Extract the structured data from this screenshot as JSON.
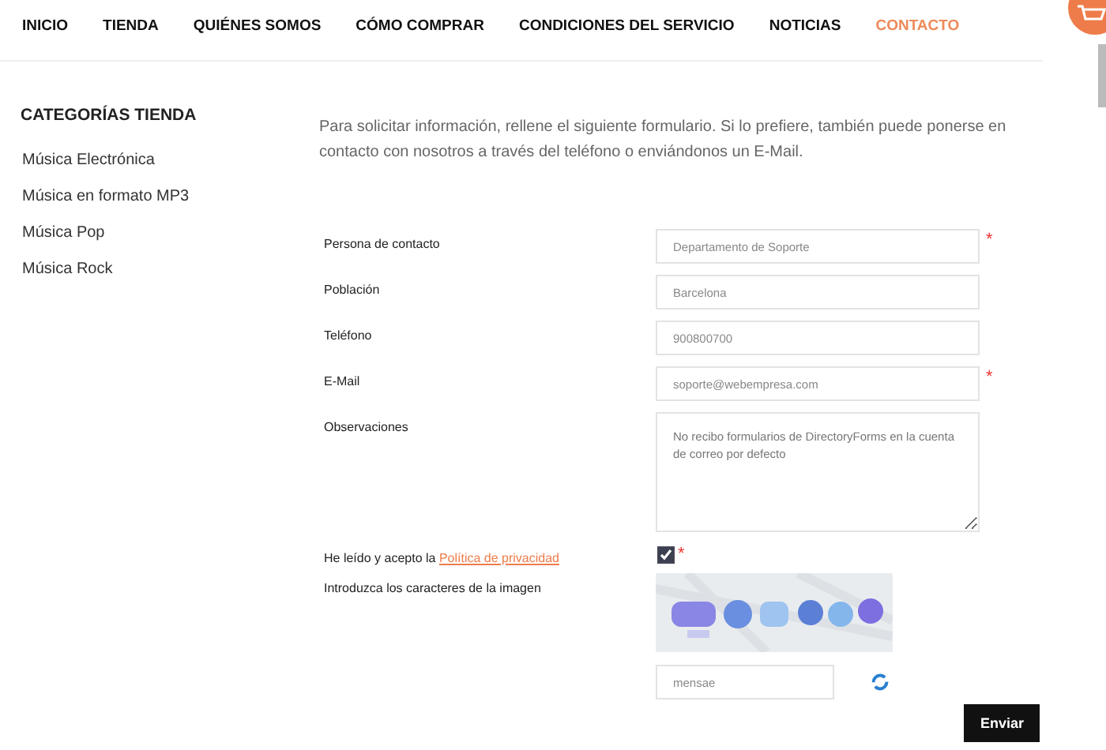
{
  "nav": [
    {
      "label": "INICIO",
      "selected": false
    },
    {
      "label": "TIENDA",
      "selected": false
    },
    {
      "label": "QUIÉNES SOMOS",
      "selected": false
    },
    {
      "label": "CÓMO COMPRAR",
      "selected": false
    },
    {
      "label": "CONDICIONES DEL SERVICIO",
      "selected": false
    },
    {
      "label": "NOTICIAS",
      "selected": false
    },
    {
      "label": "CONTACTO",
      "selected": true
    }
  ],
  "sidebar": {
    "title": "CATEGORÍAS TIENDA",
    "items": [
      "Música Electrónica",
      "Música en formato MP3",
      "Música Pop",
      "Música Rock"
    ]
  },
  "intro": "Para solicitar información, rellene el siguiente formulario. Si lo prefiere, también puede ponerse en contacto con nosotros  a través del teléfono o enviándonos un E-Mail.",
  "form": {
    "fields": [
      {
        "label": "Persona de contacto",
        "kind": "input",
        "value": "Departamento de Soporte",
        "required_marker": "*"
      },
      {
        "label": "Población",
        "kind": "input",
        "value": "Barcelona"
      },
      {
        "label": "Teléfono",
        "kind": "input",
        "value": "900800700"
      },
      {
        "label": "E-Mail",
        "kind": "input",
        "value": "soporte@webempresa.com",
        "required_marker": "*"
      },
      {
        "label": "Observaciones",
        "kind": "textarea",
        "value": "No recibo formularios de DirectoryForms en la cuenta de correo por defecto"
      }
    ],
    "privacy": {
      "text": "He leído y acepto la ",
      "link": "Política de privacidad",
      "checked": true,
      "required_marker": "*"
    },
    "captcha": {
      "label": "Introduzca los caracteres de la imagen",
      "value": "mensae"
    },
    "submit": "Enviar"
  }
}
